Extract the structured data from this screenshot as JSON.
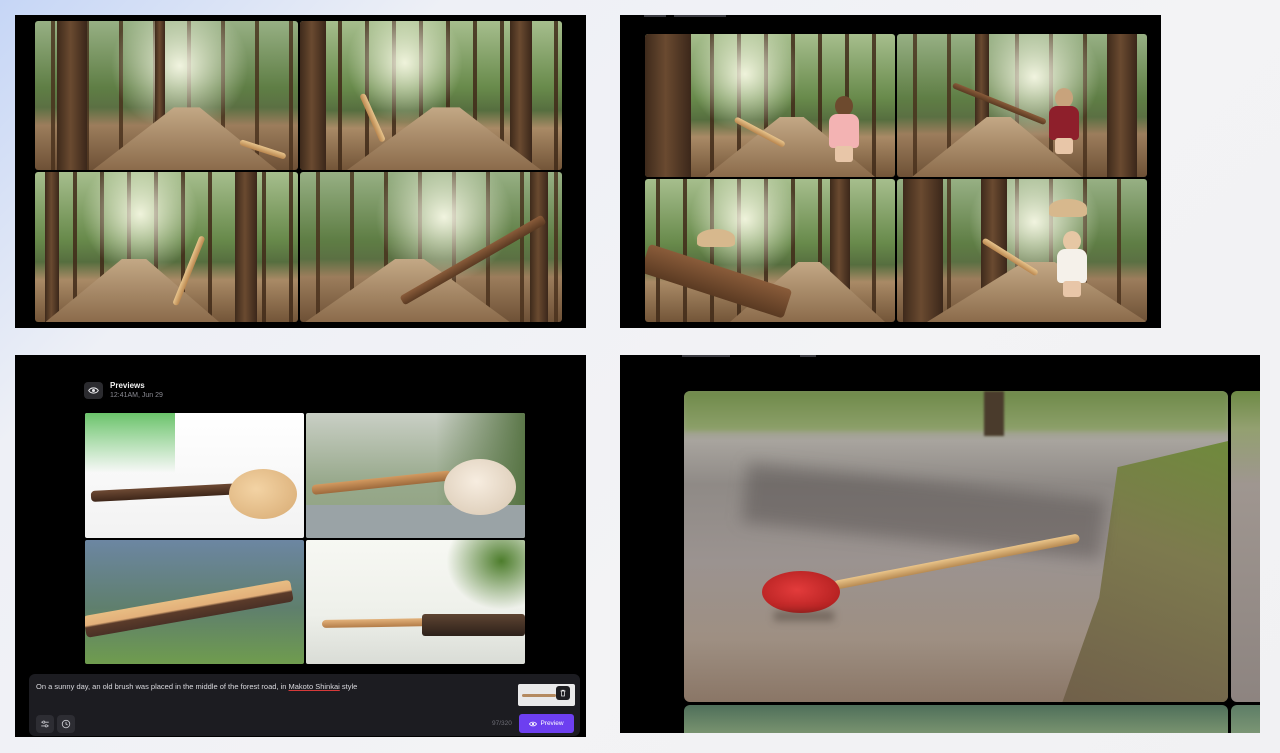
{
  "previews_panel": {
    "title": "Previews",
    "timestamp": "12:41AM, Jun 29"
  },
  "prompt": {
    "text_before": "On a sunny day, an old brush was placed in the middle of the forest road, in ",
    "text_underlined": "Makoto Shinkai",
    "text_after": " style",
    "char_count": "97/320",
    "preview_label": "Preview"
  },
  "icons": {
    "eye": "eye-icon",
    "settings": "sliders-icon",
    "history": "clock-icon",
    "delete": "trash-icon"
  },
  "colors": {
    "accent": "#6d3ff0",
    "panel_bg": "#000000",
    "prompt_bg": "#1c1c21"
  }
}
